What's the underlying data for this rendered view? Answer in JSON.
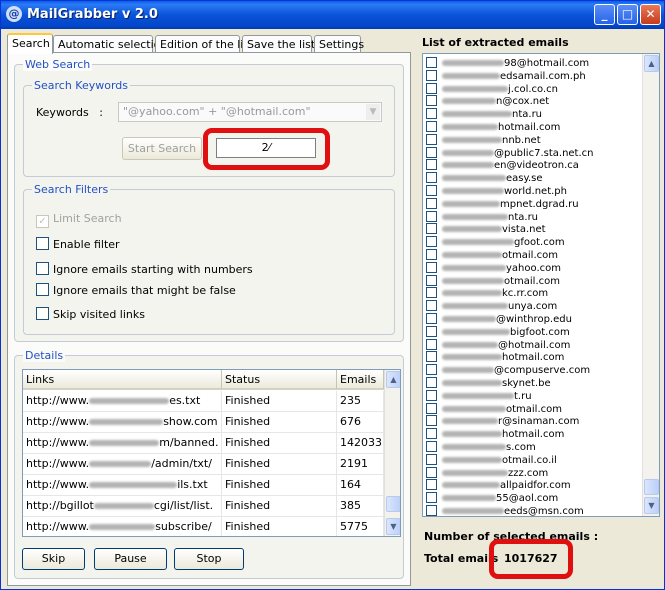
{
  "window": {
    "title": "MailGrabber v 2.0",
    "minimize": "_",
    "maximize": "□",
    "close": "✕"
  },
  "tabs": [
    {
      "label": "Search",
      "active": true
    },
    {
      "label": "Automatic selection",
      "active": false
    },
    {
      "label": "Edition of the list",
      "active": false
    },
    {
      "label": "Save the list",
      "active": false
    },
    {
      "label": "Settings",
      "active": false
    }
  ],
  "web_search": {
    "group_label": "Web Search",
    "keywords_group_label": "Search Keywords",
    "keywords_label": "Keywords   :",
    "keywords_value": "\"@yahoo.com\" + \"@hotmail.com\"",
    "start_button": "Start Search",
    "counter": "2⁄"
  },
  "filters": {
    "group_label": "Search Filters",
    "items": [
      {
        "label": "Limit Search",
        "checked": true,
        "disabled": true
      },
      {
        "label": "Enable filter",
        "checked": false,
        "disabled": false
      },
      {
        "label": "Ignore emails starting with numbers",
        "checked": false,
        "disabled": false
      },
      {
        "label": "Ignore emails that might be false",
        "checked": false,
        "disabled": false
      },
      {
        "label": "Skip visited links",
        "checked": false,
        "disabled": false
      }
    ]
  },
  "details": {
    "group_label": "Details",
    "columns": [
      "Links",
      "Status",
      "Emails"
    ],
    "rows": [
      {
        "prefix": "http://www.",
        "suffix": "es.txt",
        "status": "Finished",
        "emails": "235"
      },
      {
        "prefix": "http://www.",
        "suffix": "show.com",
        "status": "Finished",
        "emails": "676"
      },
      {
        "prefix": "http://www.",
        "suffix": "m/banned.",
        "status": "Finished",
        "emails": "142033"
      },
      {
        "prefix": "http://www.",
        "suffix": "/admin/txt/",
        "status": "Finished",
        "emails": "2191"
      },
      {
        "prefix": "http://www.",
        "suffix": "ils.txt",
        "status": "Finished",
        "emails": "164"
      },
      {
        "prefix": "http://bgillot",
        "suffix": "cgi/list/list.",
        "status": "Finished",
        "emails": "385"
      },
      {
        "prefix": "http://www.",
        "suffix": "subscribe/",
        "status": "Finished",
        "emails": "5775"
      }
    ],
    "buttons": {
      "skip": "Skip",
      "pause": "Pause",
      "stop": "Stop"
    }
  },
  "emails": {
    "header": "List of extracted emails",
    "items": [
      "98@hotmail.com",
      "edsamail.com.ph",
      "j.col.co.cn",
      "n@cox.net",
      "nta.ru",
      "hotmail.com",
      "nnb.net",
      "@public7.sta.net.cn",
      "en@videotron.ca",
      "easy.se",
      "world.net.ph",
      "mpnet.dgrad.ru",
      "nta.ru",
      "vista.net",
      "gfoot.com",
      "otmail.com",
      "yahoo.com",
      "otmail.com",
      "kc.rr.com",
      "unya.com",
      "@winthrop.edu",
      "bigfoot.com",
      "@hotmail.com",
      "hotmail.com",
      "@compuserve.com",
      "skynet.be",
      "t.ru",
      "otmail.com",
      "r@sinaman.com",
      "hotmail.com",
      "s.com",
      "otmail.co.il",
      "zzz.com",
      "allpaidfor.com",
      "55@aol.com",
      "eeds@msn.com"
    ],
    "selected_label": "Number of selected emails :",
    "total_label": "Total emails",
    "total_value": "1017627"
  },
  "colors": {
    "highlight_red": "#e01010",
    "group_label_blue": "#2251c4",
    "title_blue": "#0a53d8"
  }
}
